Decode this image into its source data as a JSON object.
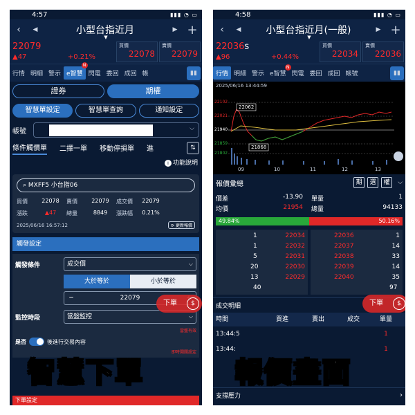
{
  "colors": {
    "up": "#ff2b2b",
    "down": "#29a83a",
    "accent": "#2b6fbe",
    "bg": "#0a1a33"
  },
  "left": {
    "status": {
      "time": "4:57"
    },
    "title": "小型台指近月",
    "quote": {
      "price": "22079",
      "change": "▲47",
      "percent": "+0.21%",
      "bid_label": "買價",
      "bid": "22078",
      "ask_label": "賣價",
      "ask": "22079"
    },
    "tabs": [
      "行情",
      "明細",
      "警示",
      "e智慧",
      "閃電",
      "委回",
      "成回",
      "帳​"
    ],
    "tab_badge": "N",
    "market_toggle": [
      "證券",
      "期權"
    ],
    "sub_toggle": [
      "智慧單設定",
      "智慧單查詢",
      "通知設定"
    ],
    "account_label": "帳號",
    "order_tabs": [
      "條件觸價單",
      "二擇一單",
      "移動停損單",
      "進"
    ],
    "help_label": "功能說明",
    "search_value": "MXFF5 小台指06",
    "quote_grid": [
      {
        "k": "買價",
        "v": "22078"
      },
      {
        "k": "賣價",
        "v": "22079"
      },
      {
        "k": "成交價",
        "v": "22079"
      },
      {
        "k": "漲跌",
        "v": "▲47"
      },
      {
        "k": "總量",
        "v": "8849"
      },
      {
        "k": "漲跌幅",
        "v": "0.21%"
      }
    ],
    "quote_time": "2025/06/16 16:57:12",
    "update_label": "更新報價",
    "trigger_header": "觸發設定",
    "trigger_condition_label": "觸發條件",
    "trigger_condition_value": "成交價",
    "compare_options": [
      "大於等於",
      "小於等於"
    ],
    "trigger_price": "22079",
    "monitor_label": "監控時段",
    "monitor_value": "當盤監控",
    "note1": "當盤有效",
    "question_label": "是否",
    "question_text": "後進行交易內容",
    "note2": "即時開關設定",
    "bottom_label": "下單設定",
    "float_btn": "下單",
    "overlay": "智慧下單"
  },
  "right": {
    "status": {
      "time": "4:58"
    },
    "title": "小型台指近月(一般)",
    "quote": {
      "price": "22036",
      "suffix": "s",
      "change": "▲96",
      "percent": "+0.44%",
      "bid_label": "買價",
      "bid": "22034",
      "ask_label": "賣價",
      "ask": "22036"
    },
    "tabs": [
      "行情",
      "明細",
      "警示",
      "e智慧",
      "閃電",
      "委回",
      "成回",
      "帳號"
    ],
    "tab_badge": "N",
    "chart_timestamp": "2025/06/16 13:44:59",
    "chart_ylabels": [
      "22102",
      "22021",
      "21940",
      "21859",
      "21802"
    ],
    "chart_xlabels": [
      "09",
      "10",
      "11",
      "12",
      "13"
    ],
    "chart_high": "22062",
    "chart_low": "21868",
    "summary_title": "報價彙總",
    "summary_btns": [
      "期",
      "選",
      "權"
    ],
    "stats": [
      {
        "k": "價差",
        "v": "-13.90",
        "k2": "單量",
        "v2": "1"
      },
      {
        "k": "均價",
        "v": "21954",
        "k2": "總量",
        "v2": "94133"
      }
    ],
    "ratio_buy": "49.84%",
    "ratio_sell": "50.16%",
    "book_bid": [
      {
        "qty": "1",
        "price": "22034"
      },
      {
        "qty": "1",
        "price": "22032"
      },
      {
        "qty": "5",
        "price": "22031"
      },
      {
        "qty": "20",
        "price": "22030"
      },
      {
        "qty": "13",
        "price": "22029"
      }
    ],
    "book_bid_total": "40",
    "book_ask": [
      {
        "price": "22036",
        "qty": "1"
      },
      {
        "price": "22037",
        "qty": "14"
      },
      {
        "price": "22038",
        "qty": "33"
      },
      {
        "price": "22039",
        "qty": "14"
      },
      {
        "price": "22040",
        "qty": "35"
      }
    ],
    "book_ask_total": "97",
    "detail_title": "成交明細",
    "detail_cols": [
      "時間",
      "買進",
      "賣出",
      "成交",
      "單量"
    ],
    "detail_rows": [
      {
        "time": "13:44:5",
        "qty": "1"
      },
      {
        "time": "13:44:",
        "qty": "1"
      }
    ],
    "support_title": "支撐壓力",
    "float_btn": "下單",
    "overlay": "報價畫面"
  }
}
